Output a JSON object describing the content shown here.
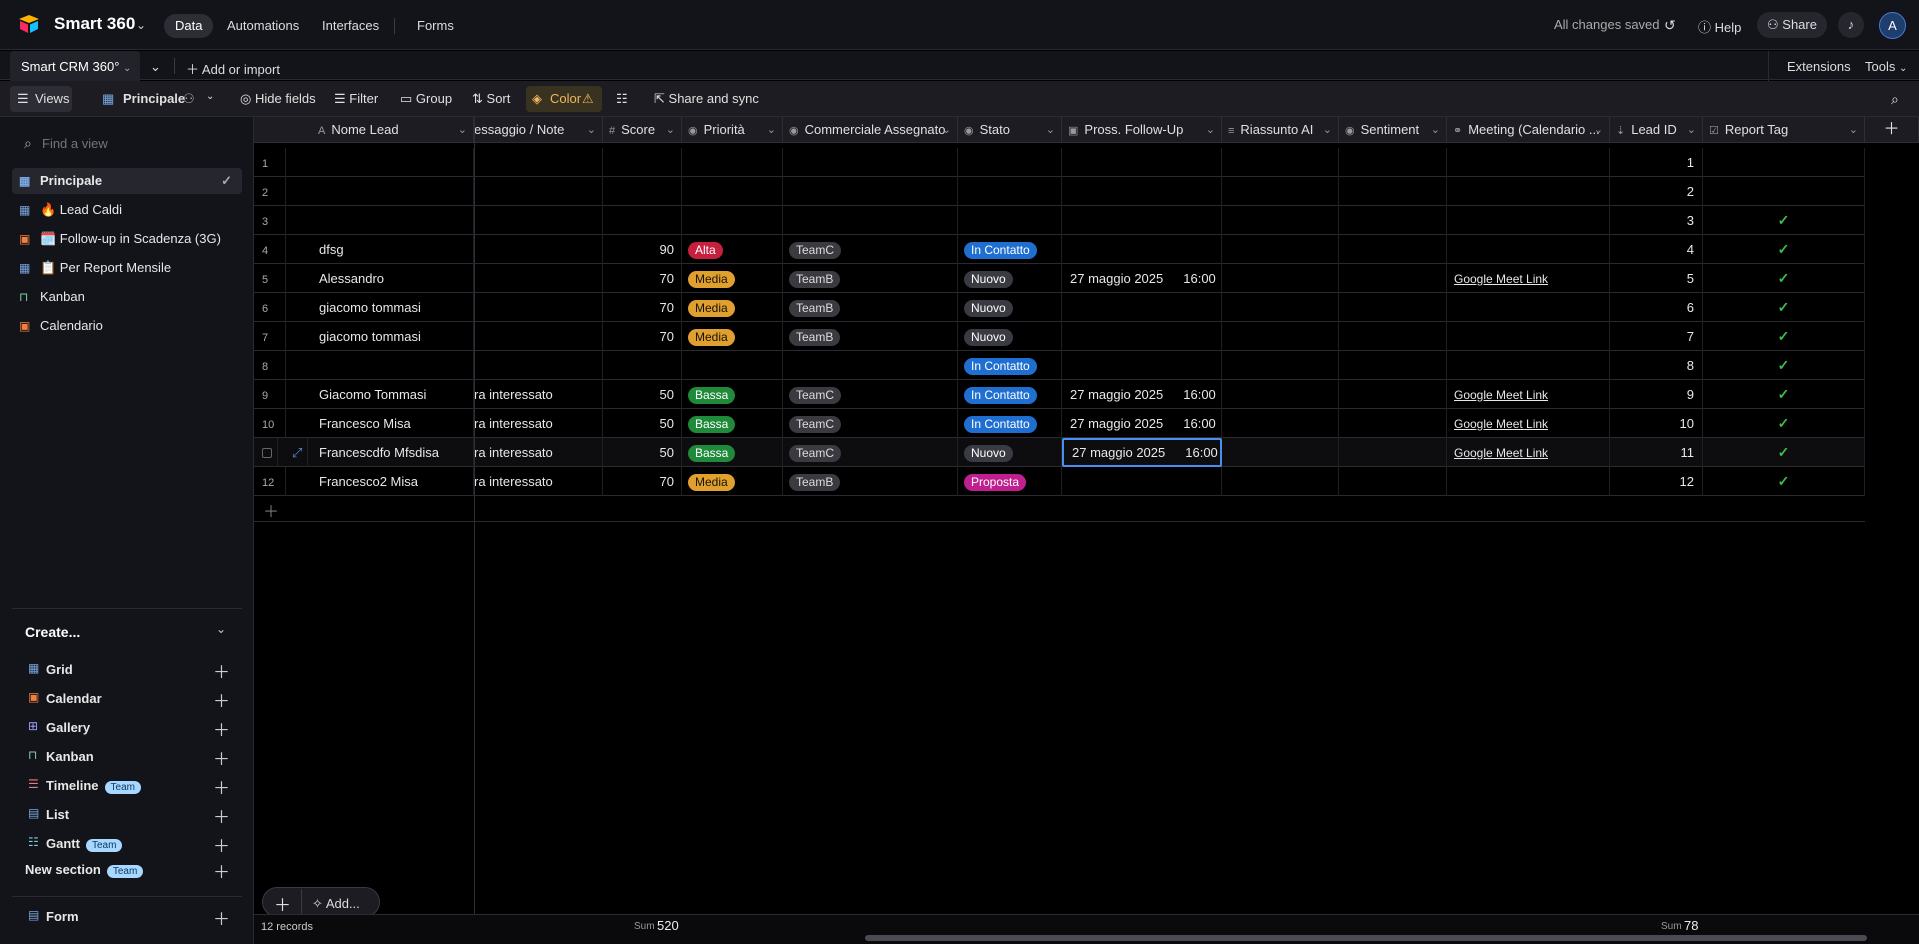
{
  "app": {
    "title": "Smart 360",
    "nav": [
      "Data",
      "Automations",
      "Interfaces",
      "Forms"
    ],
    "status": "All changes saved",
    "help": "Help",
    "share": "Share",
    "avatar": "A"
  },
  "tabs": {
    "active": "Smart CRM 360°",
    "add": "Add or import",
    "extensions": "Extensions",
    "tools": "Tools"
  },
  "toolbar": {
    "views": "Views",
    "view_name": "Principale",
    "hide_fields": "Hide fields",
    "filter": "Filter",
    "group": "Group",
    "sort": "Sort",
    "color": "Color",
    "share_sync": "Share and sync"
  },
  "sidebar": {
    "search_placeholder": "Find a view",
    "views": [
      {
        "label": "Principale",
        "icon": "grid-icon",
        "active": true
      },
      {
        "label": "🔥 Lead Caldi",
        "icon": "grid-icon"
      },
      {
        "label": "🗓️ Follow-up in Scadenza (3G)",
        "icon": "calendar-icon"
      },
      {
        "label": "📋 Per Report Mensile",
        "icon": "grid-icon"
      },
      {
        "label": "Kanban",
        "icon": "kanban-icon"
      },
      {
        "label": "Calendario",
        "icon": "calendar-icon"
      }
    ],
    "create_label": "Create...",
    "create": [
      {
        "label": "Grid",
        "icon": "grid-icon"
      },
      {
        "label": "Calendar",
        "icon": "calendar-icon"
      },
      {
        "label": "Gallery",
        "icon": "gallery-icon"
      },
      {
        "label": "Kanban",
        "icon": "kanban-icon"
      },
      {
        "label": "Timeline",
        "icon": "timeline-icon",
        "badge": "Team"
      },
      {
        "label": "List",
        "icon": "list-icon"
      },
      {
        "label": "Gantt",
        "icon": "gantt-icon",
        "badge": "Team"
      }
    ],
    "new_section": "New section",
    "new_section_badge": "Team",
    "form": "Form"
  },
  "columns": [
    "Nome Lead",
    "essaggio / Note",
    "Score",
    "Priorità",
    "Commerciale Assegnato",
    "Stato",
    "Pross. Follow-Up",
    "Riassunto AI",
    "Sentiment",
    "Meeting (Calendario ...",
    "Lead ID",
    "Report Tag"
  ],
  "rows": [
    {
      "n": "1",
      "name": "",
      "note": "",
      "score": "",
      "prio": "",
      "team": "",
      "stato": "",
      "date": "",
      "time": "",
      "meet": "",
      "id": "1",
      "tag": false
    },
    {
      "n": "2",
      "name": "",
      "note": "",
      "score": "",
      "prio": "",
      "team": "",
      "stato": "",
      "date": "",
      "time": "",
      "meet": "",
      "id": "2",
      "tag": false
    },
    {
      "n": "3",
      "name": "",
      "note": "",
      "score": "",
      "prio": "",
      "team": "",
      "stato": "",
      "date": "",
      "time": "",
      "meet": "",
      "id": "3",
      "tag": true
    },
    {
      "n": "4",
      "name": "dfsg",
      "note": "",
      "score": "90",
      "prio": "Alta",
      "team": "TeamC",
      "stato": "In Contatto",
      "date": "",
      "time": "",
      "meet": "",
      "id": "4",
      "tag": true
    },
    {
      "n": "5",
      "name": "Alessandro",
      "note": "",
      "score": "70",
      "prio": "Media",
      "team": "TeamB",
      "stato": "Nuovo",
      "date": "27 maggio 2025",
      "time": "16:00",
      "meet": "Google Meet Link",
      "id": "5",
      "tag": true
    },
    {
      "n": "6",
      "name": "giacomo tommasi",
      "note": "",
      "score": "70",
      "prio": "Media",
      "team": "TeamB",
      "stato": "Nuovo",
      "date": "",
      "time": "",
      "meet": "",
      "id": "6",
      "tag": true
    },
    {
      "n": "7",
      "name": "giacomo tommasi",
      "note": "",
      "score": "70",
      "prio": "Media",
      "team": "TeamB",
      "stato": "Nuovo",
      "date": "",
      "time": "",
      "meet": "",
      "id": "7",
      "tag": true
    },
    {
      "n": "8",
      "name": "",
      "note": "",
      "score": "",
      "prio": "",
      "team": "",
      "stato": "In Contatto",
      "date": "",
      "time": "",
      "meet": "",
      "id": "8",
      "tag": true
    },
    {
      "n": "9",
      "name": "Giacomo Tommasi",
      "note": "ra interessato",
      "score": "50",
      "prio": "Bassa",
      "team": "TeamC",
      "stato": "In Contatto",
      "date": "27 maggio 2025",
      "time": "16:00",
      "meet": "Google Meet Link",
      "id": "9",
      "tag": true
    },
    {
      "n": "10",
      "name": "Francesco Misa",
      "note": "ra interessato",
      "score": "50",
      "prio": "Bassa",
      "team": "TeamC",
      "stato": "In Contatto",
      "date": "27 maggio 2025",
      "time": "16:00",
      "meet": "Google Meet Link",
      "id": "10",
      "tag": true
    },
    {
      "n": "",
      "name": "Francescdfo Mfsdisa",
      "note": "ra interessato",
      "score": "50",
      "prio": "Bassa",
      "team": "TeamC",
      "stato": "Nuovo",
      "date": "27 maggio 2025",
      "time": "16:00",
      "meet": "Google Meet Link",
      "id": "11",
      "tag": true,
      "selected": true
    },
    {
      "n": "12",
      "name": "Francesco2 Misa",
      "note": "ra interessato",
      "score": "70",
      "prio": "Media",
      "team": "TeamB",
      "stato": "Proposta",
      "date": "",
      "time": "",
      "meet": "",
      "id": "12",
      "tag": true
    }
  ],
  "footer": {
    "add": "Add...",
    "records": "12 records",
    "sum_label": "Sum",
    "sum_score": "520",
    "sum_id": "78"
  },
  "colors": {
    "Alta": "#c7203e",
    "Media": "#e0a030",
    "Bassa": "#1f8a3a",
    "In Contatto": "#1f6fd1",
    "Nuovo": "#3a3a42",
    "Proposta": "#c0208f",
    "team": "#3a3a40"
  }
}
